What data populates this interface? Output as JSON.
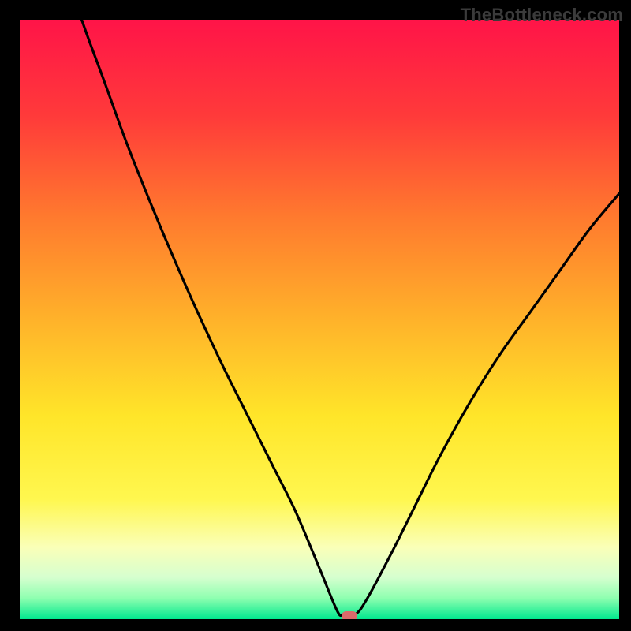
{
  "watermark": "TheBottleneck.com",
  "chart_data": {
    "type": "line",
    "title": "",
    "xlabel": "",
    "ylabel": "",
    "xlim": [
      0,
      100
    ],
    "ylim": [
      0,
      100
    ],
    "grid": false,
    "legend": false,
    "series": [
      {
        "name": "bottleneck-curve",
        "x": [
          0,
          5,
          10,
          14,
          18,
          22,
          26,
          30,
          34,
          38,
          42,
          46,
          50,
          53,
          54,
          56,
          58,
          62,
          66,
          70,
          75,
          80,
          85,
          90,
          95,
          100
        ],
        "values": [
          138,
          117,
          101,
          90,
          79,
          69,
          59.5,
          50.5,
          42,
          34,
          26,
          18,
          8.5,
          1.3,
          0.8,
          0.8,
          3.5,
          11,
          19,
          27,
          36,
          44,
          51,
          58,
          65,
          71
        ]
      }
    ],
    "marker": {
      "x": 55,
      "y": 0
    },
    "gradient_stops": [
      {
        "offset": 0.0,
        "color": "#ff1448"
      },
      {
        "offset": 0.16,
        "color": "#ff3a3a"
      },
      {
        "offset": 0.33,
        "color": "#ff7a2e"
      },
      {
        "offset": 0.5,
        "color": "#ffb22a"
      },
      {
        "offset": 0.66,
        "color": "#ffe529"
      },
      {
        "offset": 0.8,
        "color": "#fff74f"
      },
      {
        "offset": 0.88,
        "color": "#faffb8"
      },
      {
        "offset": 0.93,
        "color": "#d6ffcf"
      },
      {
        "offset": 0.965,
        "color": "#8effb0"
      },
      {
        "offset": 1.0,
        "color": "#00e88e"
      }
    ]
  }
}
